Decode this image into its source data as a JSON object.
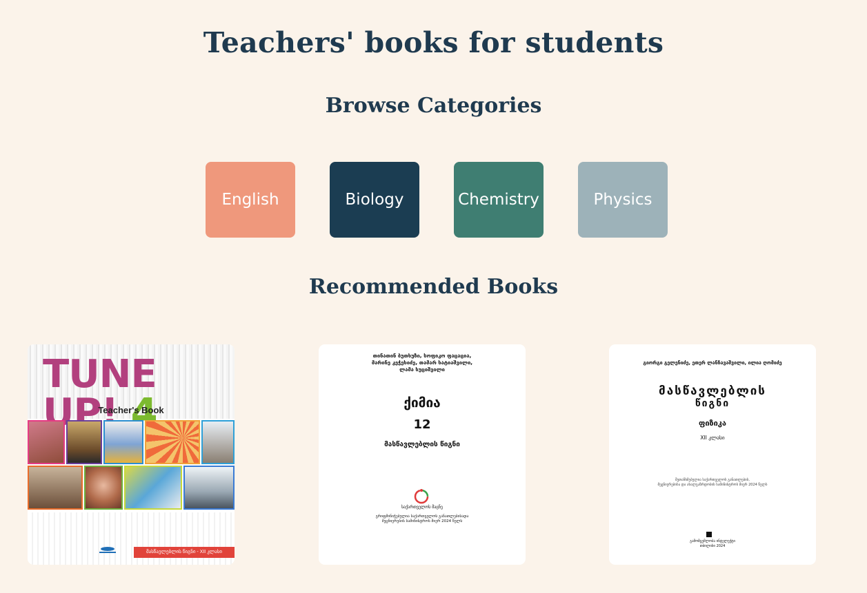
{
  "page": {
    "title": "Teachers' books for students",
    "browse_heading": "Browse Categories",
    "recommended_heading": "Recommended Books"
  },
  "categories": [
    {
      "label": "English",
      "color": "#ef987c"
    },
    {
      "label": "Biology",
      "color": "#1b3d52"
    },
    {
      "label": "Chemistry",
      "color": "#3f7e72"
    },
    {
      "label": "Physics",
      "color": "#9db2b9"
    }
  ],
  "books": [
    {
      "title_part1": "TUNE UP!",
      "title_part2": "4",
      "subtitle": "Teacher's Book",
      "bar_text": "მასწავლებლის წიგნი - XII კლასი"
    },
    {
      "authors_line1": "თინათინ ბუთხუზი, სოფიკო ფაცაცია,",
      "authors_line2": "მარინე კეჭეხიძე, თამარ ხატიაშვილი,",
      "authors_line3": "ლამა ხუციშვილი",
      "subject": "ქიმია",
      "grade": "12",
      "kind": "მასწავლებლის წიგნი",
      "publisher": "საქართველოს მაცნე",
      "approval_line1": "გრიფმინიჭებულია საქართველოს განათლებისადა",
      "approval_line2": "მეცნიერების სამინისტროს მიერ 2024 წელს"
    },
    {
      "authors": "გიორგი გელენიძე,  ეთერ ლანჩავაშვილი, ილია ღომიძე",
      "kind_line1": "მასწავლებლის",
      "kind_line2": "წიგნი",
      "subject": "ფიზიკა",
      "grade": "XII  კლასი",
      "approval_line1": "შეთანხმებულია საქართველოს განათლების,",
      "approval_line2": "მეცნიერებისა და ახალგაზრდობის სამინისტროს მიერ 2024 წელს",
      "publisher": "გამომცემლობა  ინტელექტი",
      "city_year": "თბილისი  2024"
    }
  ]
}
